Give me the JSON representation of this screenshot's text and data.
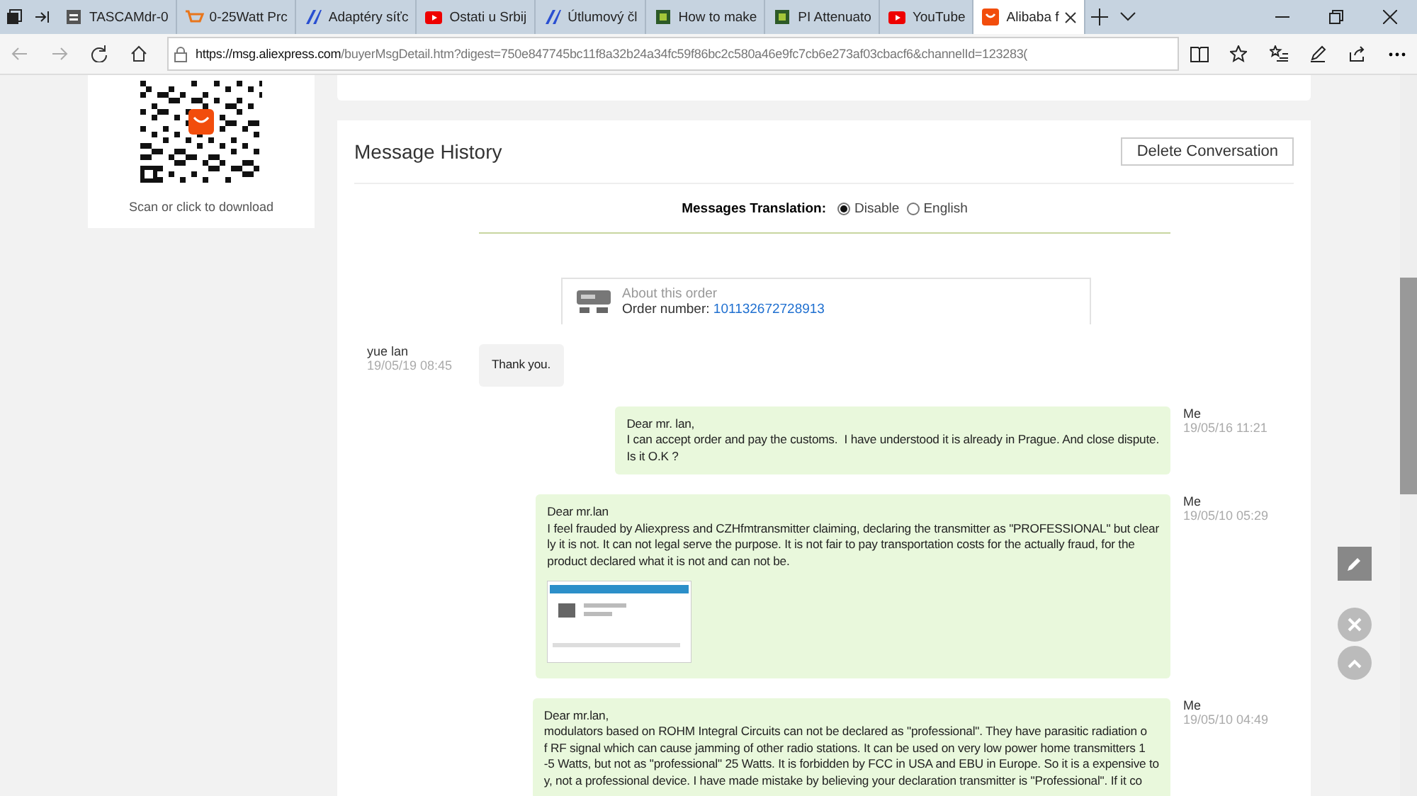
{
  "browser": {
    "tabs": [
      {
        "label": "TASCAMdr-0",
        "selected": false
      },
      {
        "label": "0-25Watt Prc",
        "selected": false
      },
      {
        "label": "Adaptéry síťc",
        "selected": false
      },
      {
        "label": "Ostati u Srbij",
        "selected": false
      },
      {
        "label": "Útlumový čl",
        "selected": false
      },
      {
        "label": "How to make",
        "selected": false
      },
      {
        "label": "PI Attenuato",
        "selected": false
      },
      {
        "label": "YouTube",
        "selected": false
      },
      {
        "label": "Alibaba f",
        "selected": true
      }
    ],
    "url_host": "https://msg.aliexpress.com",
    "url_path": "/buyerMsgDetail.htm?digest=750e847745bc11f8a32b24a34fc59f86bc2c580a46e9fc7cb6e273af03cbacf6&channelId=123283("
  },
  "app_download": {
    "caption": "Scan or click to download"
  },
  "message_history": {
    "title": "Message History",
    "delete_button": "Delete Conversation",
    "translation": {
      "label": "Messages Translation:",
      "options": [
        {
          "label": "Disable",
          "selected": true
        },
        {
          "label": "English",
          "selected": false
        }
      ]
    },
    "order": {
      "heading": "About this order",
      "number_label": "Order number:",
      "number": "101132672728913"
    },
    "messages": [
      {
        "kind": "received",
        "sender": "yue lan",
        "time": "19/05/19 08:45",
        "lines": [
          "Thank you."
        ],
        "attachment": false
      },
      {
        "kind": "sent",
        "sender": "Me",
        "time": "19/05/16 11:21",
        "lines": [
          "Dear mr. lan,",
          "I can accept order and pay the customs.  I have understood it is already in Prague. And close dispute.",
          "Is it O.K ?"
        ],
        "attachment": false
      },
      {
        "kind": "sent",
        "sender": "Me",
        "time": "19/05/10 05:29",
        "lines": [
          "Dear mr.lan",
          "I feel frauded by Aliexpress and CZHfmtransmitter claiming, declaring the transmitter as \"PROFESSIONAL\" but clear",
          "ly it is not. It can not legal serve the purpose. It is not fair to pay transportation costs for the actually fraud, for the",
          "product declared what it is not and can not be."
        ],
        "attachment": true
      },
      {
        "kind": "sent",
        "sender": "Me",
        "time": "19/05/10 04:49",
        "lines": [
          "Dear mr.lan,",
          "modulators based on ROHM Integral Circuits can not be declared as \"professional\". They have parasitic radiation o",
          "f RF signal which can cause jamming of other radio stations. It can be used on very low power home transmitters 1",
          "-5 Watts, but not as \"professional\" 25 Watts. It is forbidden by FCC in USA and EBU in Europe. So it is a expensive to",
          "y, not a professional device. I have made mistake by believing your declaration transmitter is \"Professional\". If it co"
        ],
        "attachment": false
      }
    ]
  }
}
